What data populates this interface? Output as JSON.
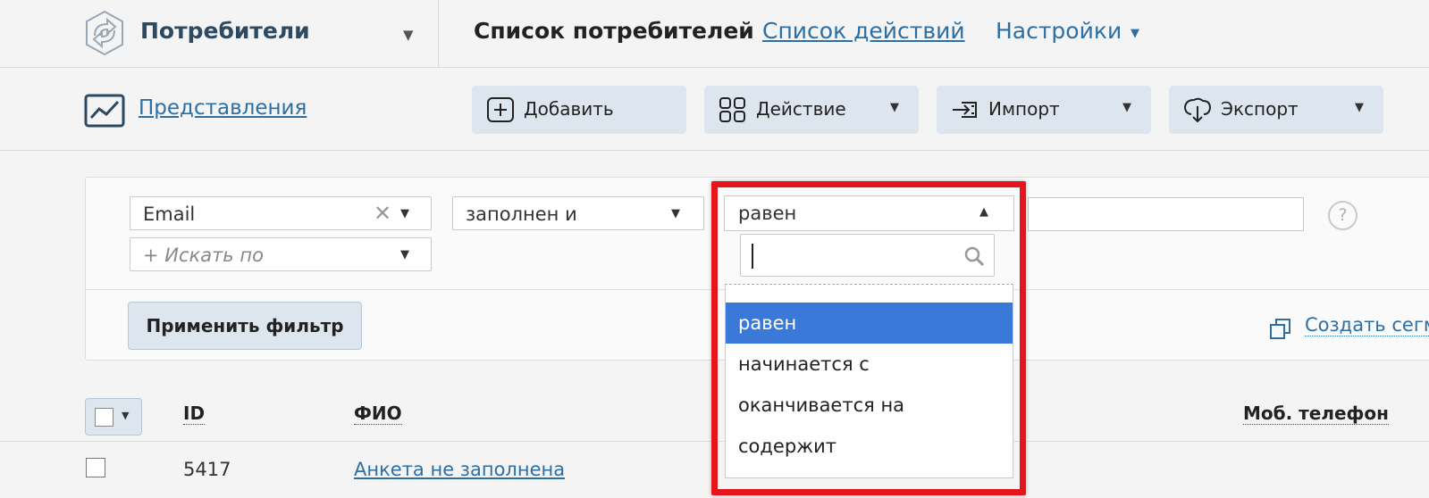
{
  "colors": {
    "accent": "#2d6fa3",
    "highlight_border": "#e8141b",
    "selected_option": "#3b79d8",
    "button_bg": "#dde6ee"
  },
  "header": {
    "app_title": "Потребители",
    "nav": {
      "active": "Список потребителей",
      "actions_link": "Список действий",
      "settings": "Настройки"
    }
  },
  "toolbar": {
    "views_link": "Представления",
    "buttons": {
      "add": "Добавить",
      "action": "Действие",
      "import": "Импорт",
      "export": "Экспорт"
    }
  },
  "filter": {
    "field": "Email",
    "search_by_placeholder": "+ Искать по",
    "condition": "заполнен и",
    "operator": "равен",
    "operator_options": [
      "равен",
      "начинается с",
      "оканчивается на",
      "содержит"
    ],
    "selected_option_index": 0,
    "help": "?",
    "apply_button": "Применить фильтр",
    "create_segment": "Создать сегм"
  },
  "table": {
    "headers": {
      "id": "ID",
      "name": "ФИО",
      "mobile": "Моб. телефон"
    },
    "rows": [
      {
        "id": "5417",
        "name": "Анкета не заполнена"
      }
    ]
  }
}
